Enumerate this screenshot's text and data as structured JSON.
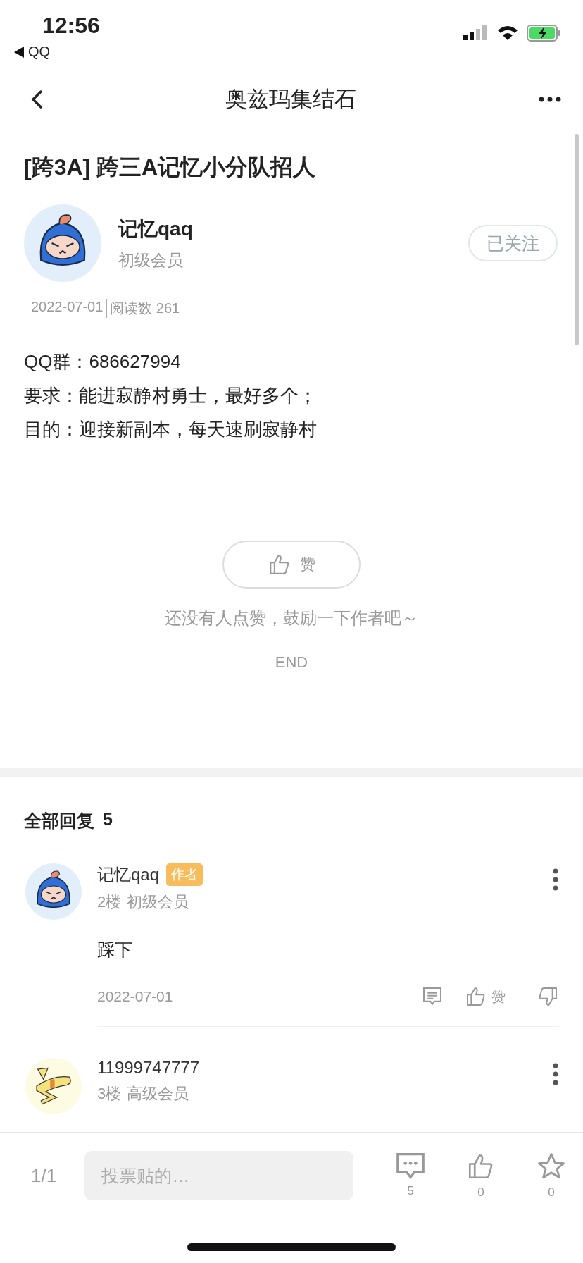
{
  "status_bar": {
    "time": "12:56",
    "back_app": "QQ"
  },
  "nav": {
    "title": "奥兹玛集结石"
  },
  "post": {
    "title": "[跨3A] 跨三A记忆小分队招人",
    "author": {
      "avatar": {
        "kind": "hood"
      },
      "name": "记忆qaq",
      "level": "初级会员",
      "follow": "已关注",
      "following": true
    },
    "date": "2022-07-01",
    "reads": "阅读数 261",
    "body": [
      "QQ群：686627994",
      "要求：能进寂静村勇士，最好多个；",
      "目的：迎接新副本，每天速刷寂静村"
    ],
    "like_label": "赞",
    "like_hint": "还没有人点赞，鼓励一下作者吧～",
    "end": "END"
  },
  "replies": {
    "title": "全部回复",
    "count": "5",
    "items": [
      {
        "avatar": {
          "kind": "hood"
        },
        "name": "记忆qaq",
        "badge": "作者",
        "floor": "2楼",
        "level": "初级会员",
        "content": "踩下",
        "date": "2022-07-01",
        "like_label": "赞"
      },
      {
        "avatar": {
          "kind": "bird"
        },
        "name": "11999747777",
        "floor": "3楼",
        "level": "高级会员"
      }
    ]
  },
  "bottom_bar": {
    "page": "1/1",
    "placeholder": "投票贴的…",
    "comments": "5",
    "likes": "0",
    "stars": "0"
  }
}
